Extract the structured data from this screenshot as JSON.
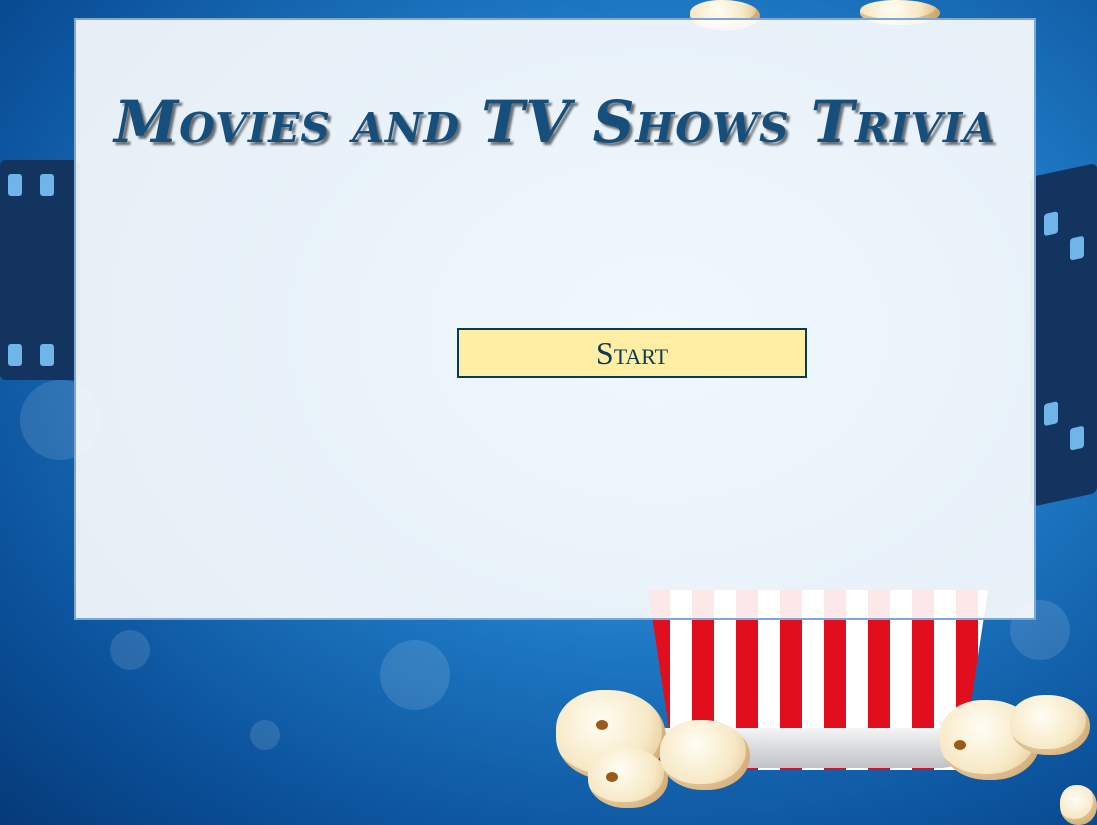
{
  "app": {
    "title": "Movies and TV Shows Trivia"
  },
  "main": {
    "start_label": "Start"
  },
  "background": {
    "theme": "cinema-popcorn",
    "icons": [
      "film-reel-icon",
      "popcorn-bucket-icon",
      "popcorn-kernel-icon"
    ]
  },
  "colors": {
    "title": "#174f7c",
    "button_bg": "#ffeea4",
    "button_border": "#0c3a52",
    "panel_border": "#7fa6d8",
    "background_blue": "#1e78c3"
  }
}
